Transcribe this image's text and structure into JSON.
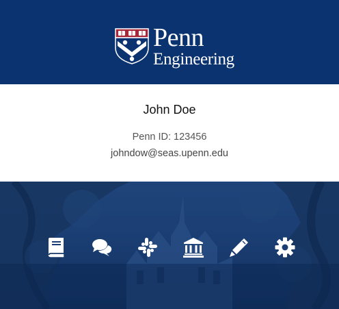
{
  "header": {
    "logo": {
      "line1": "Penn",
      "line2": "Engineering",
      "icon": "penn-shield-icon"
    },
    "background_color": "#0b3370"
  },
  "profile": {
    "name": "John Doe",
    "penn_id": "Penn ID: 123456",
    "email": "johndow@seas.upenn.edu"
  },
  "dock": {
    "icons": [
      {
        "name": "book-icon"
      },
      {
        "name": "comments-icon"
      },
      {
        "name": "slack-icon"
      },
      {
        "name": "university-icon"
      },
      {
        "name": "pencil-icon"
      },
      {
        "name": "gear-icon"
      }
    ],
    "icon_color": "#ffffff"
  }
}
